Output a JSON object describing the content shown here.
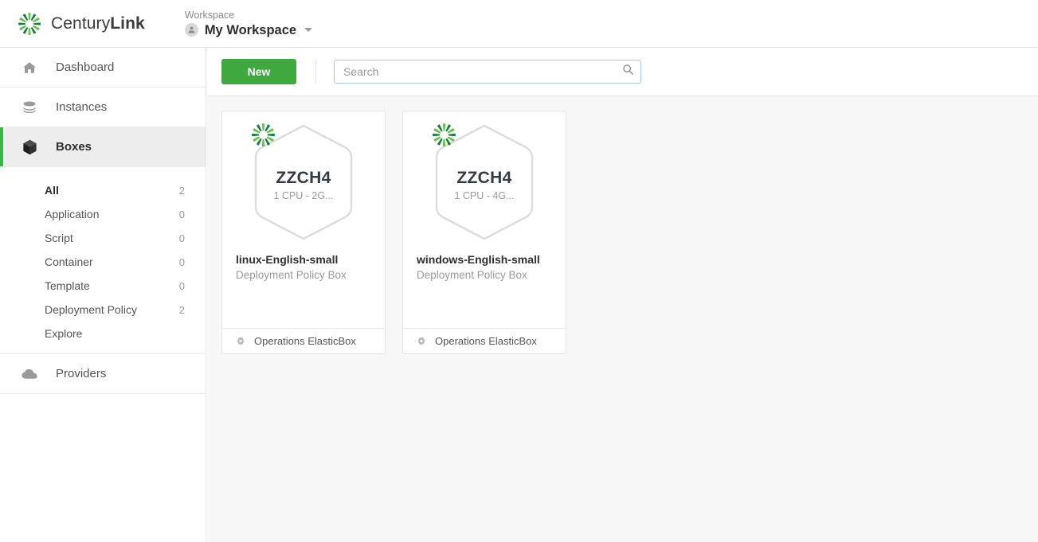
{
  "header": {
    "brand_prefix": "Century",
    "brand_suffix": "Link",
    "brand_icon": "centurylink-burst-logo",
    "workspace_label": "Workspace",
    "workspace_name": "My Workspace",
    "workspace_avatar_icon": "user-avatar-icon",
    "workspace_caret_icon": "chevron-down-icon"
  },
  "sidebar": {
    "main_items": [
      {
        "label": "Dashboard",
        "icon": "home-icon",
        "active": false
      },
      {
        "label": "Instances",
        "icon": "layers-icon",
        "active": false
      },
      {
        "label": "Boxes",
        "icon": "cube-icon",
        "active": true
      }
    ],
    "sub_items": [
      {
        "label": "All",
        "count": "2",
        "selected": true
      },
      {
        "label": "Application",
        "count": "0",
        "selected": false
      },
      {
        "label": "Script",
        "count": "0",
        "selected": false
      },
      {
        "label": "Container",
        "count": "0",
        "selected": false
      },
      {
        "label": "Template",
        "count": "0",
        "selected": false
      },
      {
        "label": "Deployment Policy",
        "count": "2",
        "selected": false
      },
      {
        "label": "Explore",
        "count": "",
        "selected": false
      }
    ],
    "providers": {
      "label": "Providers",
      "icon": "cloud-icon"
    }
  },
  "toolbar": {
    "new_label": "New",
    "search_placeholder": "Search",
    "search_value": "",
    "search_icon": "search-icon"
  },
  "cards": [
    {
      "badge_code": "ZZCH4",
      "badge_spec": "1 CPU - 2G...",
      "badge_icon": "centurylink-burst-logo",
      "title": "linux-English-small",
      "subtitle": "Deployment Policy Box",
      "footer_label": "Operations ElasticBox",
      "footer_icon": "gear-icon"
    },
    {
      "badge_code": "ZZCH4",
      "badge_spec": "1 CPU - 4G...",
      "badge_icon": "centurylink-burst-logo",
      "title": "windows-English-small",
      "subtitle": "Deployment Policy Box",
      "footer_label": "Operations ElasticBox",
      "footer_icon": "gear-icon"
    }
  ],
  "colors": {
    "accent_green": "#3db549",
    "button_green": "#3fa93f",
    "focus_blue": "#a5c9ea",
    "content_bg": "#f7f7f7"
  }
}
